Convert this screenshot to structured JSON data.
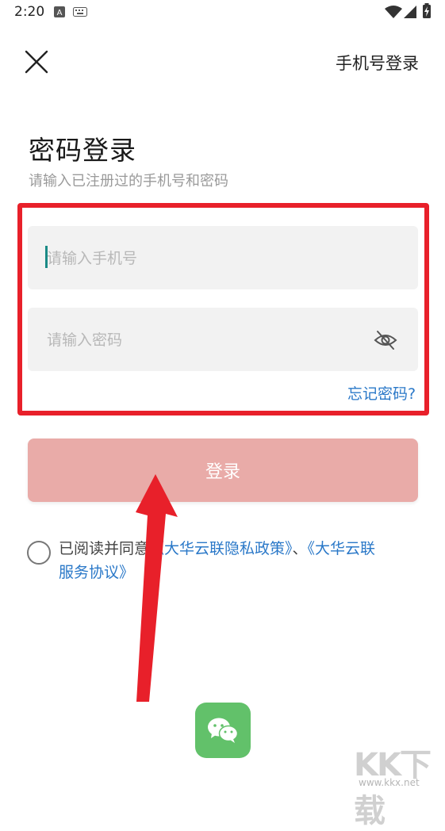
{
  "status_bar": {
    "time": "2:20",
    "icons": [
      "a-badge-icon",
      "keyboard-icon",
      "wifi-icon",
      "cellular-signal-icon",
      "battery-charging-icon"
    ]
  },
  "header": {
    "close_icon": "close-icon",
    "phone_login_label": "手机号登录"
  },
  "title": "密码登录",
  "subtitle": "请输入已注册过的手机号和密码",
  "form": {
    "phone_placeholder": "请输入手机号",
    "password_placeholder": "请输入密码",
    "password_toggle_icon": "eye-off-icon",
    "forgot_label": "忘记密码?",
    "login_label": "登录"
  },
  "agreement": {
    "prefix": "已阅读并同意",
    "privacy_link": "《大华云联隐私政策》",
    "separator": "、",
    "service_link_part1": "《大华云联",
    "service_link_part2": "服务协议》"
  },
  "social": {
    "wechat_icon": "wechat-icon"
  },
  "watermark": {
    "logo": "KK下载",
    "url": "www.kkx.net"
  },
  "colors": {
    "highlight": "#e8202a",
    "login_button": "#e9aba8",
    "link": "#2a78c8",
    "wechat": "#62c16a",
    "field_bg": "#f2f2f2"
  }
}
